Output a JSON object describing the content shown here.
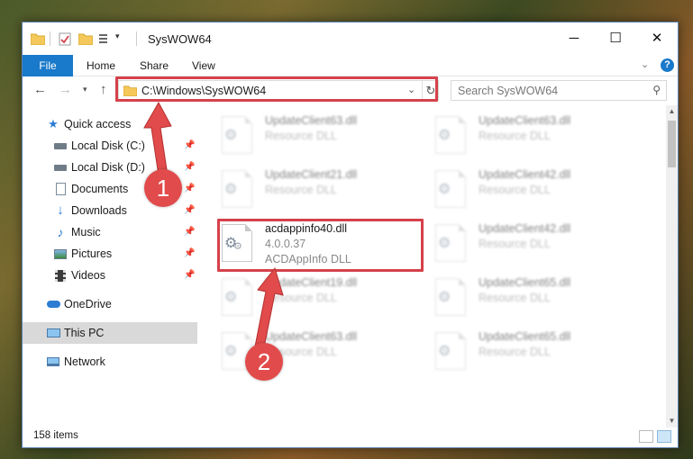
{
  "window": {
    "title": "SysWOW64",
    "controls": {
      "minimize": "─",
      "maximize": "☐",
      "close": "✕"
    }
  },
  "ribbon": {
    "tabs": [
      "File",
      "Home",
      "Share",
      "View"
    ],
    "help": "?"
  },
  "nav": {
    "address": "C:\\Windows\\SysWOW64",
    "search_placeholder": "Search SysWOW64"
  },
  "sidebar": {
    "items": [
      {
        "label": "Quick access",
        "icon": "star-icon"
      },
      {
        "label": "Local Disk (C:)",
        "icon": "drive-icon",
        "pinned": true
      },
      {
        "label": "Local Disk (D:)",
        "icon": "drive-icon",
        "pinned": true
      },
      {
        "label": "Documents",
        "icon": "documents-icon",
        "pinned": true
      },
      {
        "label": "Downloads",
        "icon": "download-icon",
        "pinned": true
      },
      {
        "label": "Music",
        "icon": "music-icon",
        "pinned": true
      },
      {
        "label": "Pictures",
        "icon": "pictures-icon",
        "pinned": true
      },
      {
        "label": "Videos",
        "icon": "videos-icon",
        "pinned": true
      },
      {
        "label": "OneDrive",
        "icon": "cloud-icon"
      },
      {
        "label": "This PC",
        "icon": "computer-icon",
        "selected": true
      },
      {
        "label": "Network",
        "icon": "network-icon"
      }
    ]
  },
  "files": {
    "left": [
      {
        "name": "UpdateClient63.dll",
        "desc": "Resource DLL"
      },
      {
        "name": "UpdateClient21.dll",
        "desc": "Resource DLL"
      },
      {
        "name": "acdappinfo40.dll",
        "version": "4.0.0.37",
        "desc": "ACDAppInfo DLL"
      },
      {
        "name": "UpdateClient19.dll",
        "desc": "Resource DLL"
      },
      {
        "name": "UpdateClient63.dll",
        "desc": "Resource DLL"
      }
    ],
    "right": [
      {
        "name": "UpdateClient63.dll",
        "desc": "Resource DLL"
      },
      {
        "name": "UpdateClient42.dll",
        "desc": "Resource DLL"
      },
      {
        "name": "UpdateClient42.dll",
        "desc": "Resource DLL"
      },
      {
        "name": "UpdateClient65.dll",
        "desc": "Resource DLL"
      },
      {
        "name": "UpdateClient65.dll",
        "desc": "Resource DLL"
      }
    ]
  },
  "status": {
    "item_count": "158 items"
  },
  "annotations": {
    "step1": "1",
    "step2": "2",
    "color": "#d6414b"
  }
}
